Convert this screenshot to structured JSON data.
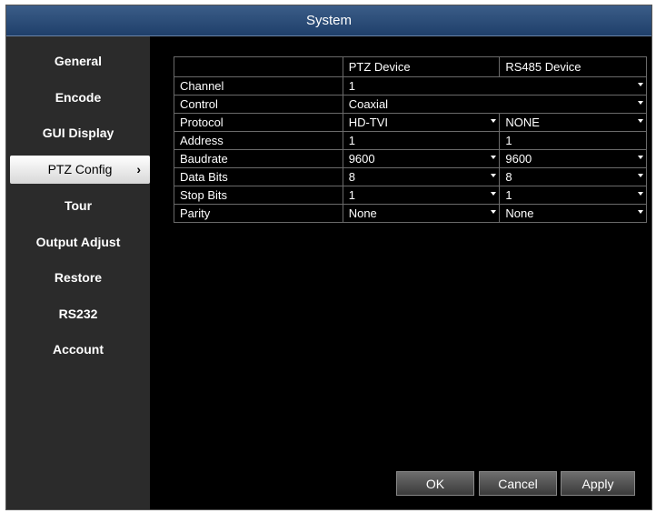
{
  "window": {
    "title": "System"
  },
  "sidebar": {
    "items": [
      {
        "label": "General"
      },
      {
        "label": "Encode"
      },
      {
        "label": "GUI Display"
      },
      {
        "label": "PTZ Config",
        "active": true
      },
      {
        "label": "Tour"
      },
      {
        "label": "Output Adjust"
      },
      {
        "label": "Restore"
      },
      {
        "label": "RS232"
      },
      {
        "label": "Account"
      }
    ]
  },
  "table": {
    "headers": [
      "",
      "PTZ Device",
      "RS485 Device"
    ],
    "rows": [
      {
        "label": "Channel",
        "ptz": "1",
        "rs485": ""
      },
      {
        "label": "Control",
        "ptz": "Coaxial",
        "rs485": ""
      },
      {
        "label": "Protocol",
        "ptz": "HD-TVI",
        "rs485": "NONE"
      },
      {
        "label": "Address",
        "ptz": "1",
        "rs485": "1"
      },
      {
        "label": "Baudrate",
        "ptz": "9600",
        "rs485": "9600"
      },
      {
        "label": "Data Bits",
        "ptz": "8",
        "rs485": "8"
      },
      {
        "label": "Stop Bits",
        "ptz": "1",
        "rs485": "1"
      },
      {
        "label": "Parity",
        "ptz": "None",
        "rs485": "None"
      }
    ]
  },
  "buttons": {
    "ok": "OK",
    "cancel": "Cancel",
    "apply": "Apply"
  },
  "icons": {
    "active_item_chevron": "chevron-right-icon",
    "dropdown": "caret-down-icon"
  },
  "colors": {
    "titlebar": "#2d4f7c",
    "sidebar": "#2b2b2b",
    "background": "#000000",
    "active_item": "#ffffff"
  }
}
